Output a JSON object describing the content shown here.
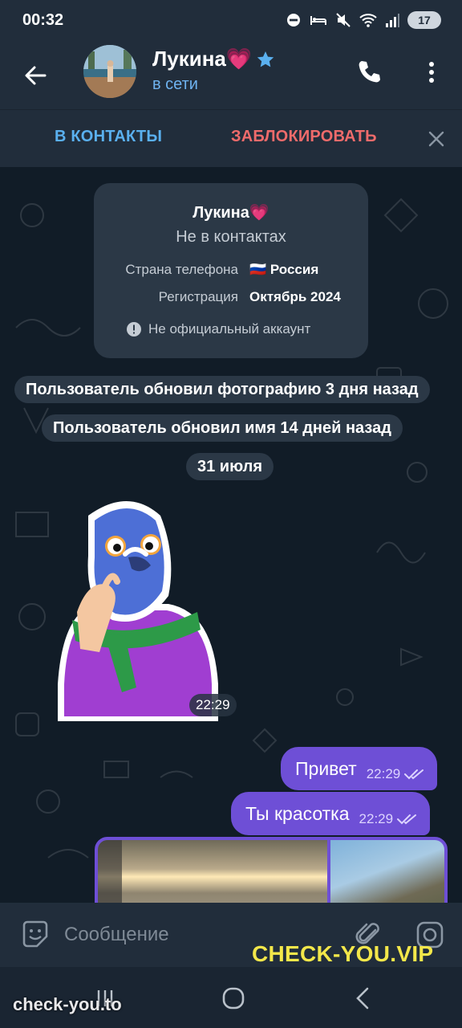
{
  "status_bar": {
    "time": "00:32",
    "battery": "17"
  },
  "header": {
    "title": "Лукина💗",
    "status": "в сети"
  },
  "actions": {
    "add_contact": "В КОНТАКТЫ",
    "block": "ЗАБЛОКИРОВАТЬ"
  },
  "info_card": {
    "name": "Лукина💗",
    "subtitle": "Не в контактах",
    "phone_country_label": "Страна телефона",
    "phone_country_value": "🇷🇺 Россия",
    "registration_label": "Регистрация",
    "registration_value": "Октябрь 2024",
    "note": "Не официальный аккаунт"
  },
  "service_messages": {
    "photo_updated": "Пользователь обновил фотографию 3 дня назад",
    "name_updated": "Пользователь обновил имя 14 дней назад",
    "date": "31 июля"
  },
  "messages": [
    {
      "kind": "sticker",
      "time": "22:29"
    },
    {
      "kind": "outgoing",
      "text": "Привет",
      "time": "22:29"
    },
    {
      "kind": "outgoing",
      "text": "Ты красотка",
      "time": "22:29"
    }
  ],
  "composer": {
    "placeholder": "Сообщение"
  },
  "watermarks": {
    "primary": "CHECK-YOU.VIP",
    "secondary": "check-you.to"
  },
  "colors": {
    "accent": "#5ab0ef",
    "danger": "#ef6b6b",
    "outgoing_bubble": "#6e4fd6",
    "watermark": "#f3e74a"
  }
}
